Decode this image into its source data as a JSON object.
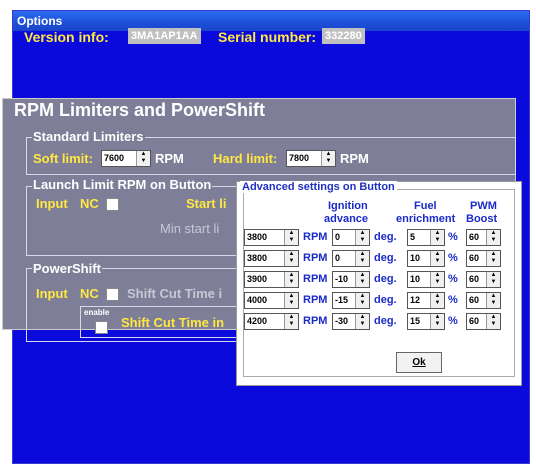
{
  "window": {
    "title": "Options"
  },
  "info": {
    "version_label": "Version info:",
    "version_value": "3MA1AP1AA",
    "serial_label": "Serial number:",
    "serial_value": "332280"
  },
  "section": {
    "title": "RPM Limiters and PowerShift",
    "standard": {
      "title": "Standard Limiters",
      "soft_label": "Soft limit:",
      "soft_value": "7600",
      "soft_unit": "RPM",
      "hard_label": "Hard limit:",
      "hard_value": "7800",
      "hard_unit": "RPM"
    },
    "launch": {
      "title": "Launch Limit RPM on Button",
      "input_label": "Input",
      "nc_label": "NC",
      "start_label": "Start li",
      "min_start_label": "Min start li"
    },
    "powershift": {
      "title": "PowerShift",
      "input_label": "Input",
      "nc_label": "NC",
      "shift_cut_label1": "Shift Cut Time i",
      "enable_label": "enable",
      "shift_cut_label2": "Shift Cut Time in"
    }
  },
  "advanced": {
    "title": "Advanced settings on Button",
    "headers": {
      "ignition": [
        "Ignition",
        "advance"
      ],
      "fuel": [
        "Fuel",
        "enrichment"
      ],
      "pwm": [
        "PWM",
        "Boost"
      ]
    },
    "units": {
      "rpm": "RPM",
      "deg": "deg.",
      "pct": "%"
    },
    "rows": [
      {
        "rpm": "3800",
        "ign": "0",
        "fuel": "5",
        "pwm": "60"
      },
      {
        "rpm": "3800",
        "ign": "0",
        "fuel": "10",
        "pwm": "60"
      },
      {
        "rpm": "3900",
        "ign": "-10",
        "fuel": "10",
        "pwm": "60"
      },
      {
        "rpm": "4000",
        "ign": "-15",
        "fuel": "12",
        "pwm": "60"
      },
      {
        "rpm": "4200",
        "ign": "-30",
        "fuel": "15",
        "pwm": "60"
      }
    ],
    "ok_label": "Ok"
  }
}
